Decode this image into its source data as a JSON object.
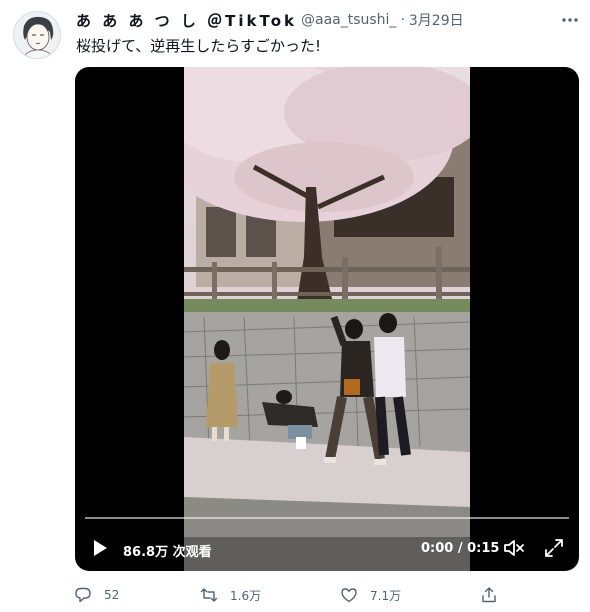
{
  "tweet": {
    "author": {
      "display_name": "あ あ あ つ し ＠TikTok",
      "handle": "@aaa_tsushi_",
      "separator": "·",
      "date": "3月29日"
    },
    "text": "桜投げて、逆再生したらすごかった!",
    "more_icon": "more-horizontal-icon"
  },
  "video": {
    "views": "86.8万 次观看",
    "time": "0:00 / 0:15",
    "progress": 0,
    "icons": [
      "play-icon",
      "volume-icon",
      "fullscreen-icon"
    ]
  },
  "actions": {
    "reply_count": "52",
    "retweet_count": "1.6万",
    "like_count": "7.1万",
    "icons": [
      "reply-icon",
      "retweet-icon",
      "like-icon",
      "share-icon"
    ]
  },
  "colors": {
    "text_primary": "#0f1419",
    "text_secondary": "#536471",
    "media_background": "#000000"
  }
}
